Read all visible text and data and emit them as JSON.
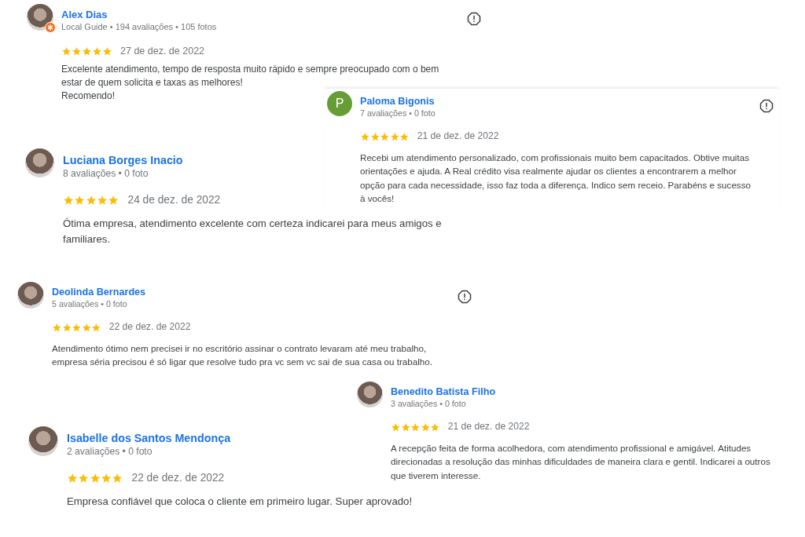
{
  "reviews": [
    {
      "name": "Alex Dias",
      "meta": "Local Guide • 194 avaliações • 105 fotos",
      "avatar": {
        "kind": "photo",
        "badge": true
      },
      "report_icon": true,
      "stars": 5,
      "date": "27 de dez. de 2022",
      "text": "Excelente atendimento, tempo de resposta muito rápido e sempre preocupado com o bem estar de quem solicita e taxas as melhores!\nRecomendo!"
    },
    {
      "name": "Paloma Bigonis",
      "meta": "7 avaliações • 0 foto",
      "avatar": {
        "kind": "letter",
        "initial": "P",
        "badge": false
      },
      "report_icon": true,
      "stars": 5,
      "date": "21 de dez. de 2022",
      "text": "Recebi um atendimento personalizado, com profissionais muito bem capacitados. Obtive muitas orientações e ajuda. A Real crédito visa realmente ajudar os clientes a encontrarem a melhor opção para cada necessidade, isso faz toda a diferença. Indico sem receio. Parabéns e sucesso à vocês!"
    },
    {
      "name": "Luciana Borges Inacio",
      "meta": "8 avaliações • 0 foto",
      "avatar": {
        "kind": "photo",
        "badge": false
      },
      "report_icon": false,
      "stars": 5,
      "date": "24 de dez. de 2022",
      "text": "Ótima empresa, atendimento excelente com certeza indicarei para meus amigos e familiares."
    },
    {
      "name": "Deolinda Bernardes",
      "meta": "5 avaliações • 0 foto",
      "avatar": {
        "kind": "photo",
        "badge": false
      },
      "report_icon": true,
      "stars": 5,
      "date": "22 de dez. de 2022",
      "text": "Atendimento ótimo nem precisei ir no escritório assinar o contrato levaram até meu trabalho, empresa séria precisou é só ligar que resolve tudo pra vc sem vc sai de sua casa ou trabalho."
    },
    {
      "name": "Benedito Batista Filho",
      "meta": "3 avaliações • 0 foto",
      "avatar": {
        "kind": "photo",
        "badge": false
      },
      "report_icon": false,
      "stars": 5,
      "date": "21 de dez. de 2022",
      "text": "A recepção feita de forma acolhedora, com atendimento profissional e amigável. Atitudes direcionadas a resolução das minhas dificuldades de maneira clara e gentil. Indicarei a outros que tiverem interesse."
    },
    {
      "name": "Isabelle dos Santos Mendonça",
      "meta": "2 avaliações • 0 foto",
      "avatar": {
        "kind": "photo",
        "badge": false
      },
      "report_icon": false,
      "stars": 5,
      "date": "22 de dez. de 2022",
      "text": "Empresa confiável que coloca o cliente em primeiro lugar. Super aprovado!"
    }
  ]
}
